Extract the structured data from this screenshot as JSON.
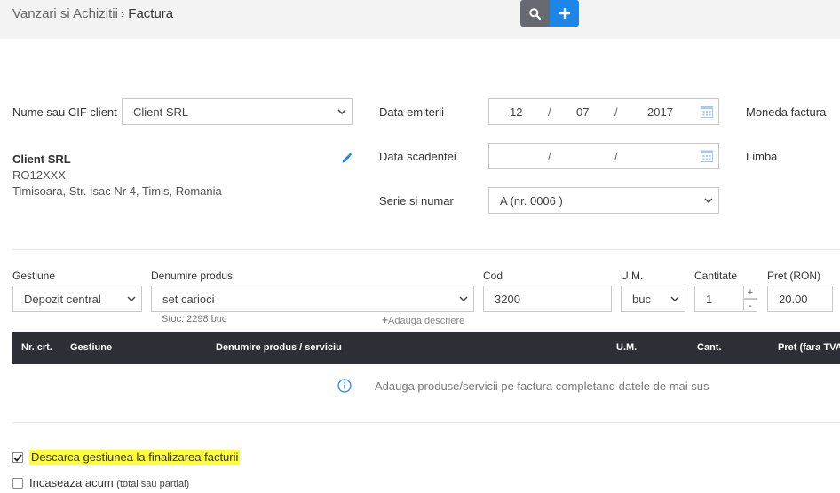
{
  "breadcrumb": {
    "parent": "Vanzari si Achizitii",
    "separator": "›",
    "current": "Factura"
  },
  "toolbar": {
    "search_icon": "search-icon",
    "add_icon": "plus-icon"
  },
  "client": {
    "label": "Nume sau CIF client",
    "selected": "Client SRL",
    "name": "Client SRL",
    "cif": "RO12XXX",
    "address": "Timisoara, Str. Isac Nr 4, Timis, Romania"
  },
  "dates": {
    "issue_label": "Data emiterii",
    "issue_day": "12",
    "issue_month": "07",
    "issue_year": "2017",
    "due_label": "Data scadentei",
    "slash": "/"
  },
  "series": {
    "label": "Serie si numar",
    "value": "A (nr. 0006 )"
  },
  "right_labels": {
    "currency": "Moneda factura",
    "language": "Limba"
  },
  "product_form": {
    "warehouse_label": "Gestiune",
    "warehouse_value": "Depozit central",
    "product_label": "Denumire produs",
    "product_value": "set carioci",
    "stock": "Stoc: 2298 buc",
    "add_description": "Adauga descriere",
    "code_label": "Cod",
    "code_value": "3200",
    "unit_label": "U.M.",
    "unit_value": "buc",
    "qty_label": "Cantitate",
    "qty_value": "1",
    "qty_plus": "+",
    "qty_minus": "-",
    "price_label": "Pret (RON)",
    "price_value": "20.00"
  },
  "table": {
    "columns": [
      "Nr. crt.",
      "Gestiune",
      "Denumire produs / serviciu",
      "U.M.",
      "Cant.",
      "Pret (fara TVA)"
    ],
    "empty_message": "Adauga produse/servicii pe factura completand datele de mai sus"
  },
  "options": {
    "unload_stock": "Descarca gestiunea la finalizarea facturii",
    "unload_stock_checked": true,
    "collect_now": "Incaseaza acum",
    "collect_now_hint": "(total sau partial)",
    "collect_now_checked": false
  },
  "colors": {
    "accent": "#1d86e6",
    "header_dark": "#2c2f36",
    "highlight": "#fdfd3a"
  }
}
